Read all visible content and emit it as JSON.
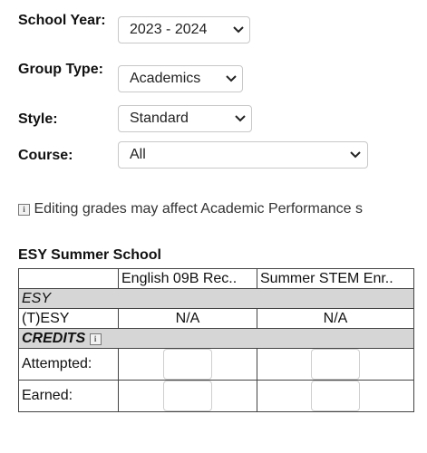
{
  "filters": {
    "school_year": {
      "label": "School Year:",
      "value": "2023 - 2024"
    },
    "group_type": {
      "label": "Group Type:",
      "value": "Academics"
    },
    "style": {
      "label": "Style:",
      "value": "Standard"
    },
    "course": {
      "label": "Course:",
      "value": "All"
    }
  },
  "notice": "Editing grades may affect Academic Performance s",
  "section": {
    "title": "ESY Summer School",
    "columns": [
      "English 09B Rec..",
      "Summer STEM Enr.."
    ],
    "group_label": "ESY",
    "esy_row": {
      "label": "(T)ESY",
      "values": [
        "N/A",
        "N/A"
      ]
    },
    "credits_label": "CREDITS",
    "attempted_label": "Attempted:",
    "earned_label": "Earned:"
  }
}
